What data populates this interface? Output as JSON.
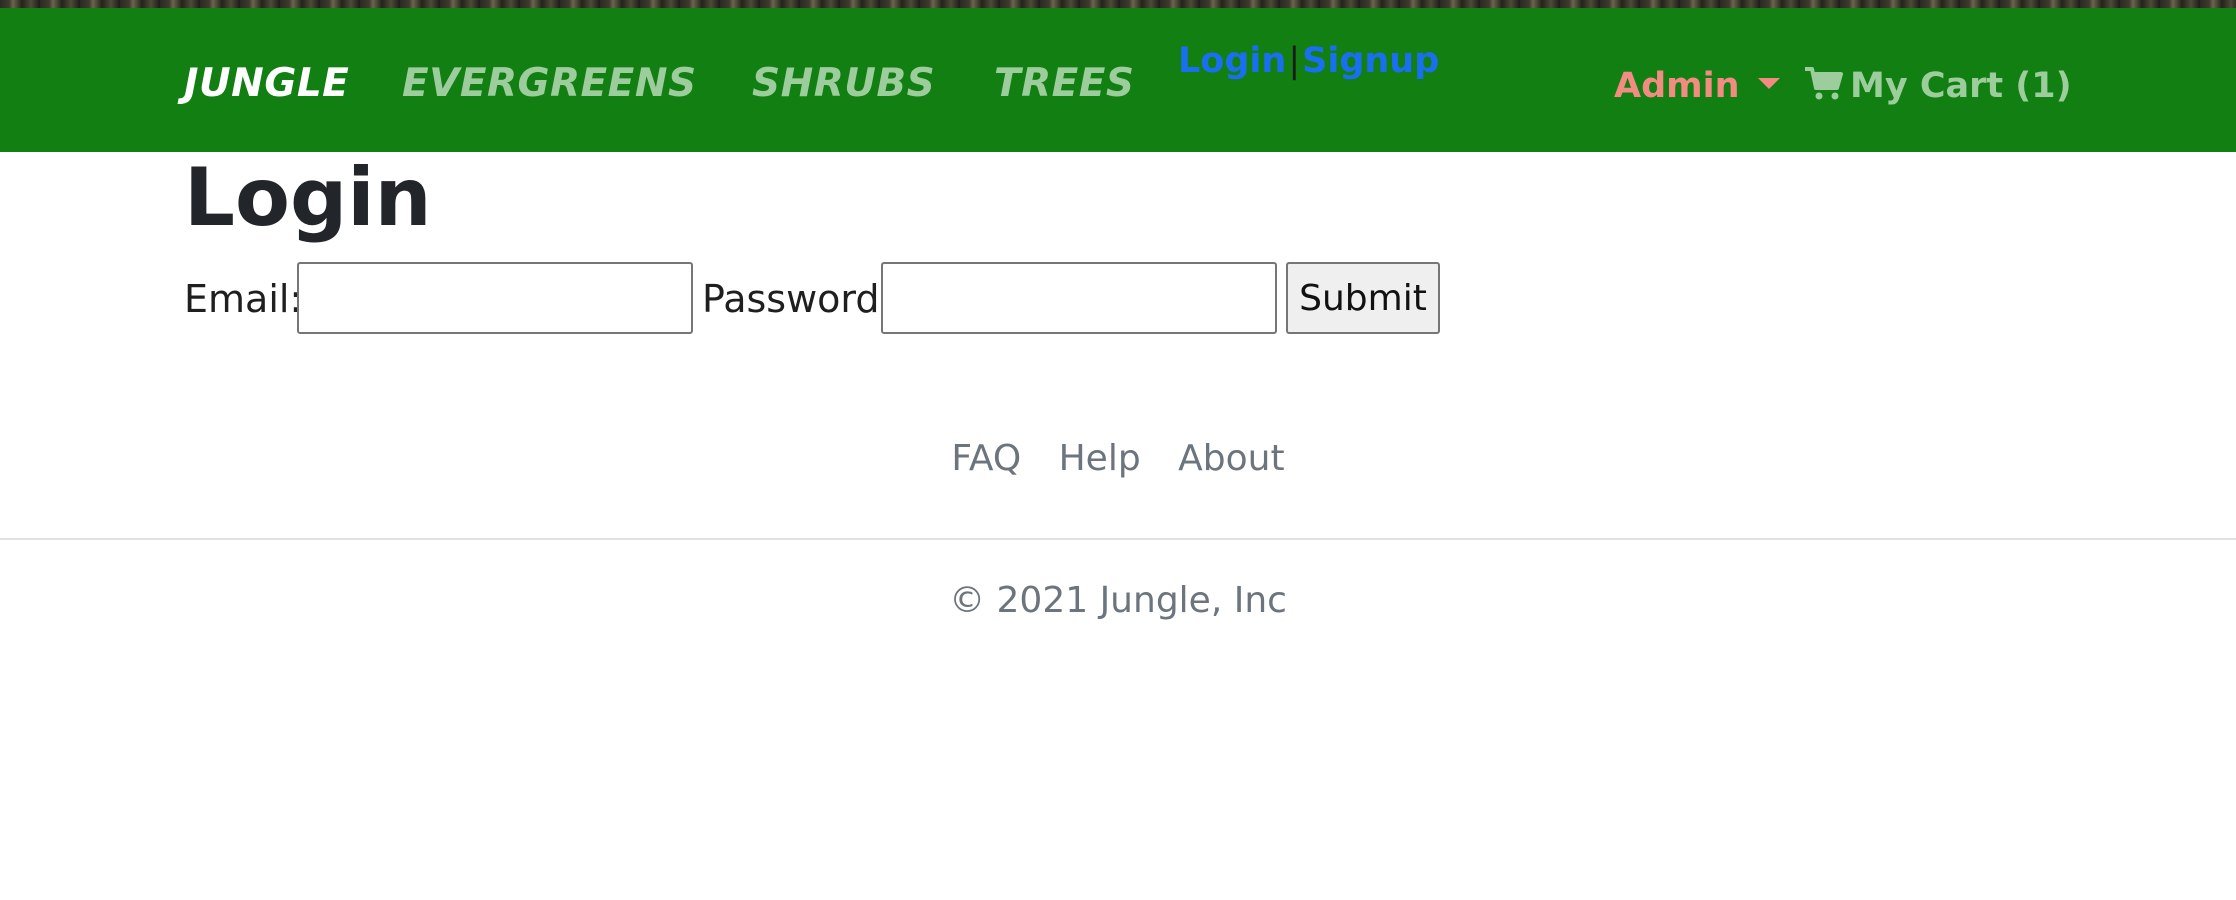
{
  "navbar": {
    "brand": "JUNGLE",
    "links": [
      "EVERGREENS",
      "SHRUBS",
      "TREES"
    ],
    "login_label": "Login",
    "separator": "|",
    "signup_label": "Signup",
    "admin_label": "Admin",
    "cart_label": "My Cart (1)",
    "background_color": "#117f11"
  },
  "main": {
    "title": "Login",
    "email_label": "Email:",
    "email_value": "",
    "password_label": "Password:",
    "password_value": "",
    "submit_label": "Submit"
  },
  "footer": {
    "links": [
      "FAQ",
      "Help",
      "About"
    ],
    "copyright": "© 2021 Jungle, Inc"
  },
  "icons": {
    "cart": "shopping-cart-icon",
    "dropdown": "caret-down-icon"
  }
}
